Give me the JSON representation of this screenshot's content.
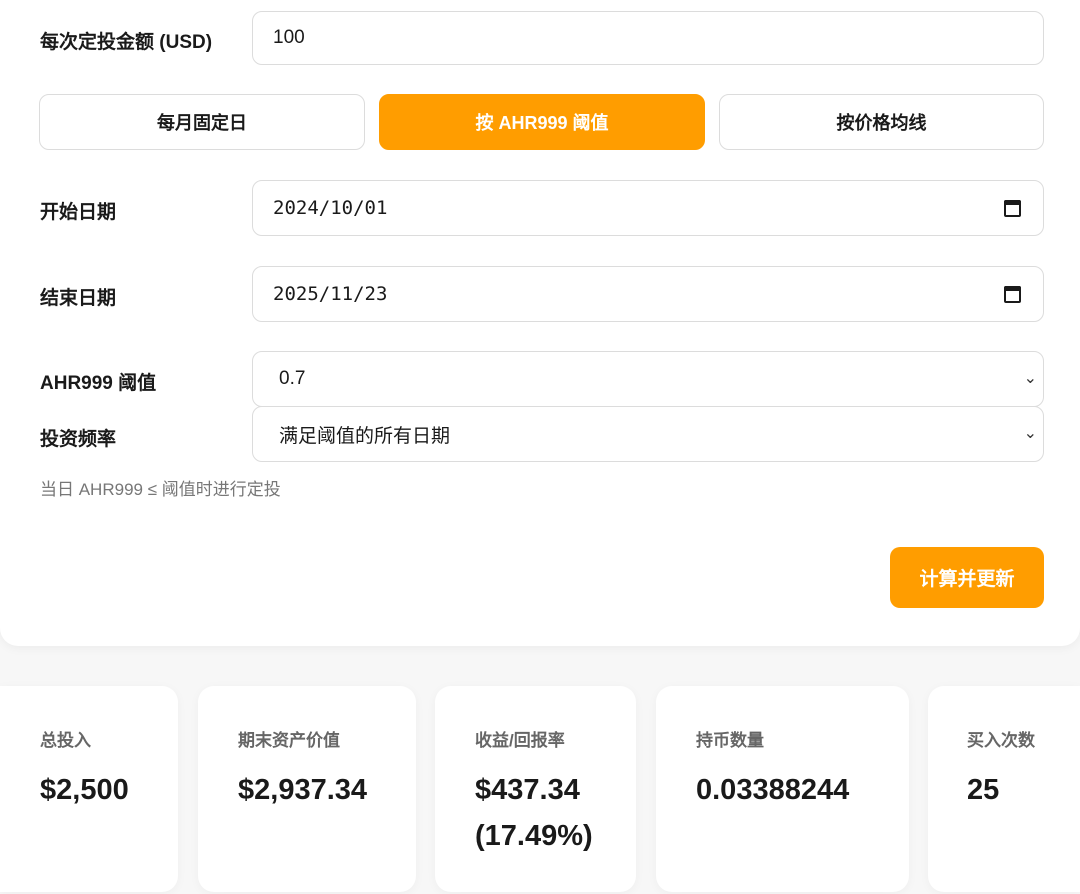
{
  "form": {
    "amount_label": "每次定投金额 (USD)",
    "amount_value": "100",
    "modes": [
      {
        "label": "每月固定日",
        "active": false
      },
      {
        "label": "按 AHR999 阈值",
        "active": true
      },
      {
        "label": "按价格均线",
        "active": false
      }
    ],
    "start_date_label": "开始日期",
    "start_date_value": "2024/10/01",
    "end_date_label": "结束日期",
    "end_date_value": "2025/11/23",
    "threshold_label": "AHR999 阈值",
    "threshold_value": "0.7",
    "frequency_label": "投资频率",
    "frequency_value": "满足阈值的所有日期",
    "hint": "当日 AHR999 ≤ 阈值时进行定投",
    "calc_button": "计算并更新"
  },
  "stats": [
    {
      "title": "总投入",
      "value": "$2,500"
    },
    {
      "title": "期末资产价值",
      "value": "$2,937.34"
    },
    {
      "title": "收益/回报率",
      "value": "$437.34 (17.49%)"
    },
    {
      "title": "持币数量",
      "value": "0.03388244"
    },
    {
      "title": "买入次数",
      "value": "25"
    }
  ],
  "colors": {
    "accent": "#ff9d00",
    "background": "#f7f7f7"
  },
  "icons": {
    "calendar": "calendar-icon",
    "chevron": "chevron-down-icon"
  }
}
